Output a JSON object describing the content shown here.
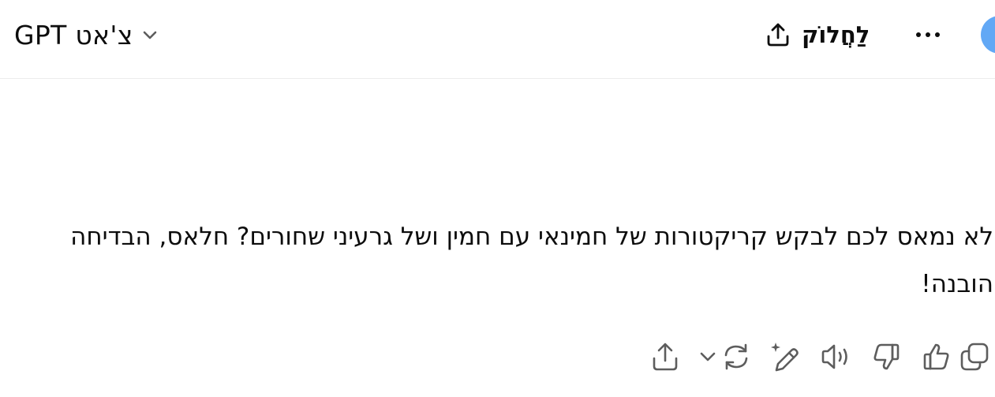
{
  "header": {
    "model_name": "צ'אט GPT",
    "share_label": "לַחֲלוֹק"
  },
  "message": {
    "text": "לא נמאס לכם לבקש קריקטורות של חמינאי עם חמין ושל גרעיני שחורים? חלאס, הבדיחה הובנה!"
  },
  "icons": {
    "model_chevron": "chevron-down-icon",
    "share": "share-icon",
    "more": "more-horizontal-icon",
    "copy": "copy-icon",
    "like": "thumbs-up-icon",
    "dislike": "thumbs-down-icon",
    "read_aloud": "speaker-icon",
    "edit": "edit-sparkle-icon",
    "regenerate": "refresh-icon",
    "share_message": "share-icon"
  },
  "colors": {
    "avatar": "#62a8f5",
    "icon": "#5d5d5d",
    "text": "#0d0d0d"
  }
}
